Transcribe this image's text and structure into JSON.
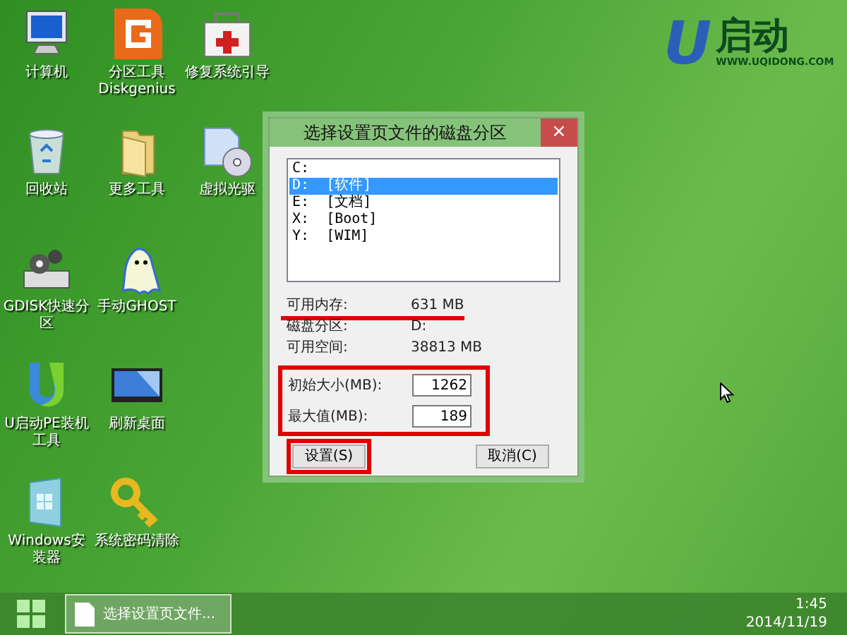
{
  "desktop_icons": [
    {
      "label": "计算机",
      "kind": "computer"
    },
    {
      "label": "回收站",
      "kind": "recycle"
    },
    {
      "label": "GDISK快速分区",
      "kind": "gdisk"
    },
    {
      "label": "U启动PE装机工具",
      "kind": "ulogo"
    },
    {
      "label": "Windows安装器",
      "kind": "wininstall"
    },
    {
      "label": "分区工具 Diskgenius",
      "kind": "diskgenius"
    },
    {
      "label": "更多工具",
      "kind": "folder"
    },
    {
      "label": "手动GHOST",
      "kind": "ghost"
    },
    {
      "label": "刷新桌面",
      "kind": "screen"
    },
    {
      "label": "系统密码清除",
      "kind": "key"
    },
    {
      "label": "修复系统引导",
      "kind": "firstaid"
    },
    {
      "label": "虚拟光驱",
      "kind": "disc"
    }
  ],
  "wallpaper_logo": {
    "mark": "U",
    "name": "启动",
    "url": "WWW.UQIDONG.COM"
  },
  "dialog": {
    "title": "选择设置页文件的磁盘分区",
    "close": "×",
    "drives": [
      {
        "label": "C:",
        "selected": false
      },
      {
        "label": "D:  [软件]",
        "selected": true
      },
      {
        "label": "E:  [文档]",
        "selected": false
      },
      {
        "label": "X:  [Boot]",
        "selected": false
      },
      {
        "label": "Y:  [WIM]",
        "selected": false
      }
    ],
    "info_rows": [
      {
        "label": "可用内存:",
        "value": "631 MB",
        "underlined": true
      },
      {
        "label": "磁盘分区:",
        "value": "D:"
      },
      {
        "label": "可用空间:",
        "value": "38813 MB"
      }
    ],
    "size_fields": {
      "annotated": true,
      "fields": [
        {
          "label": "初始大小(MB):",
          "value": "1262"
        },
        {
          "label": "最大值(MB):",
          "value": "189"
        }
      ]
    },
    "buttons": [
      {
        "label": "设置(S)",
        "annotated": true
      },
      {
        "label": "取消(C)",
        "annotated": false
      }
    ]
  },
  "taskbar": {
    "task": {
      "label": "选择设置页文件...",
      "selected": true
    },
    "time": "1:45",
    "date": "2014/11/19"
  }
}
